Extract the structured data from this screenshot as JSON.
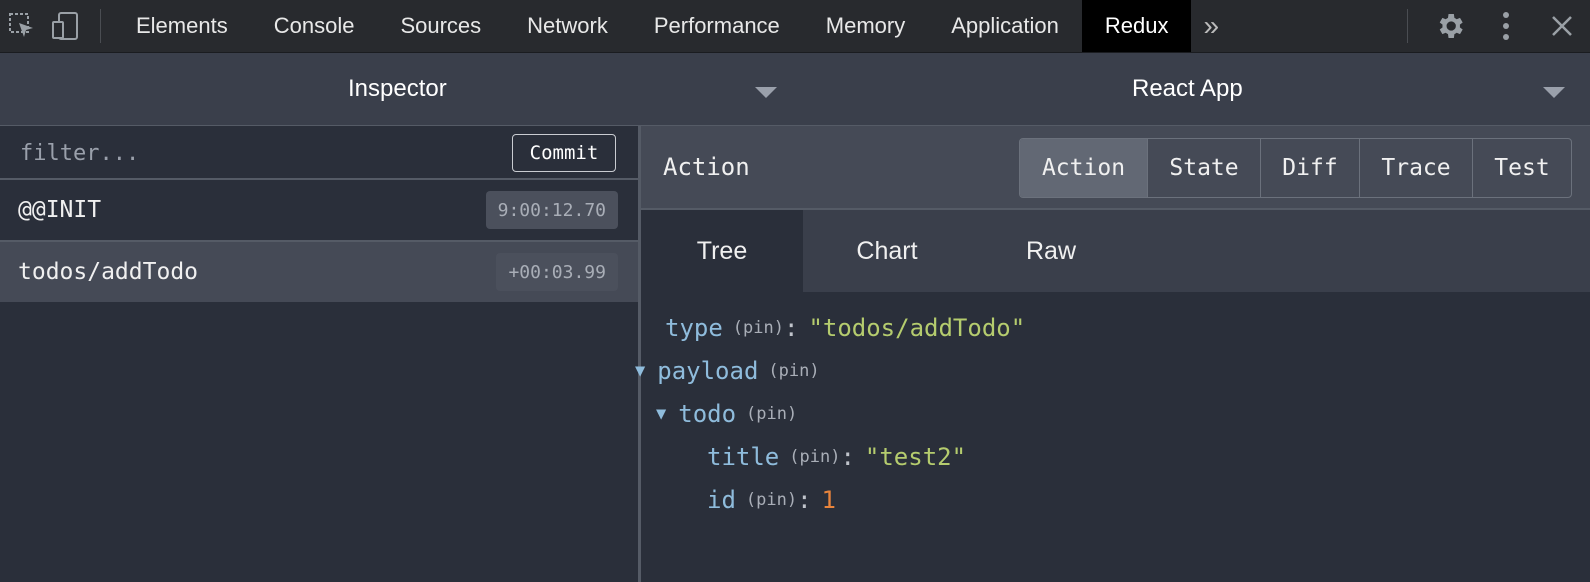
{
  "devtools": {
    "tabs": [
      "Elements",
      "Console",
      "Sources",
      "Network",
      "Performance",
      "Memory",
      "Application",
      "Redux"
    ],
    "active_tab": "Redux",
    "more_tabs_glyph": "»",
    "icons": [
      "inspect-element-icon",
      "device-toolbar-icon",
      "settings-gear-icon",
      "more-vert-icon",
      "close-icon"
    ]
  },
  "subbar": {
    "monitor": "Inspector",
    "instance": "React App"
  },
  "actions_panel": {
    "filter_placeholder": "filter...",
    "commit_label": "Commit",
    "items": [
      {
        "name": "@@INIT",
        "time": "9:00:12.70"
      },
      {
        "name": "todos/addTodo",
        "time": "+00:03.99"
      }
    ],
    "selected": "todos/addTodo"
  },
  "detail": {
    "title": "Action",
    "modes": [
      "Action",
      "State",
      "Diff",
      "Trace",
      "Test"
    ],
    "active_mode": "Action",
    "views": [
      "Tree",
      "Chart",
      "Raw"
    ],
    "active_view": "Tree",
    "pin_label": "(pin)",
    "tree": {
      "type_key": "type",
      "type_value": "\"todos/addTodo\"",
      "payload_key": "payload",
      "todo_key": "todo",
      "title_key": "title",
      "title_value": "\"test2\"",
      "id_key": "id",
      "id_value": "1",
      "colon": ":",
      "expanded_glyph": "▼"
    }
  },
  "colors": {
    "accent_key": "#8fbcdc",
    "string": "#b5cc6e",
    "number": "#e8843c",
    "active_tab_bg": "#000000"
  }
}
